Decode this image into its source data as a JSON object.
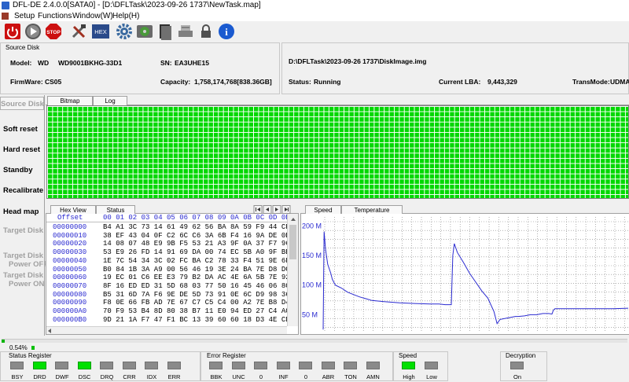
{
  "title": "DFL-DE 2.4.0.0[SATA0] - [D:\\DFLTask\\2023-09-26 1737\\NewTask.map]",
  "menu": [
    "Setup",
    "Functions",
    "Window(W)",
    "Help(H)"
  ],
  "toolbar": [
    {
      "name": "power-icon",
      "color": "#cc1010"
    },
    {
      "name": "play-icon",
      "color": "#404040"
    },
    {
      "name": "stop-icon",
      "color": "#cc1010",
      "label": "STOP"
    },
    {
      "name": "tools-icon",
      "color": "#505050"
    },
    {
      "name": "hex-icon",
      "color": "#2a4a8a",
      "label": "HEX"
    },
    {
      "name": "gear-icon",
      "color": "#3a6aa0"
    },
    {
      "name": "refresh-disk-icon",
      "color": "#4a8a3a"
    },
    {
      "name": "document-icon",
      "color": "#404040"
    },
    {
      "name": "disk-tools-icon",
      "color": "#606060"
    },
    {
      "name": "lock-icon",
      "color": "#505050"
    },
    {
      "name": "info-icon",
      "color": "#1a5ad0",
      "label": "i"
    }
  ],
  "source_disk": {
    "group_label": "Source Disk",
    "model_label": "Model:",
    "model_vendor": "WD",
    "model": "WD9001BKHG-33D1",
    "sn_label": "SN:",
    "sn": "EA3UHE15",
    "firmware_label": "FirmWare:",
    "firmware": "CS05",
    "capacity_label": "Capacity:",
    "capacity": "1,758,174,768[838.36GB]"
  },
  "task": {
    "image_path": "D:\\DFLTask\\2023-09-26 1737\\DiskImage.img",
    "status_label": "Status:",
    "status": "Running",
    "lba_label": "Current LBA:",
    "lba": "9,443,329",
    "transmode_label": "TransMode:",
    "transmode": "UDMA"
  },
  "sidebar": {
    "source_disk": "Source Disk",
    "soft_reset": "Soft reset",
    "hard_reset": "Hard reset",
    "standby": "Standby",
    "recalibrate": "Recalibrate",
    "head_map": "Head map",
    "target_disk": "Target Disk",
    "target_power_off": [
      "Target Disk",
      "Power OFF"
    ],
    "target_power_on": [
      "Target Disk",
      "Power ON"
    ]
  },
  "bitmap_tabs": [
    "Bitmap",
    "Log"
  ],
  "bitmap": {
    "cell_color": "#00d800",
    "filled_fraction": 1.0
  },
  "hex_tabs": [
    "Hex View",
    "Status"
  ],
  "hex": {
    "offset_header": "Offset",
    "col_header": "00 01 02 03 04 05 06 07 08 09 0A 0B 0C 0D 0E",
    "rows": [
      {
        "offset": "00000000",
        "bytes": "B4 A1 3C 73 14 61 49 62 56 BA 8A 59 F9 44 CF"
      },
      {
        "offset": "00000010",
        "bytes": "38 EF 43 04 0F C2 6C C6 3A 6B F4 16 9A DE 0E"
      },
      {
        "offset": "00000020",
        "bytes": "14 08 07 48 E9 9B F5 53 21 A3 9F 0A 37 F7 96"
      },
      {
        "offset": "00000030",
        "bytes": "53 E9 26 FD 14 91 69 DA 00 74 EC 5B A0 9F BE"
      },
      {
        "offset": "00000040",
        "bytes": "1E 7C 54 34 3C 02 FC BA C2 78 33 F4 51 9E 6F"
      },
      {
        "offset": "00000050",
        "bytes": "B0 84 1B 3A A9 00 56 46 19 3E 24 BA 7E D8 DC"
      },
      {
        "offset": "00000060",
        "bytes": "19 EC 01 C6 EE E3 79 B2 DA AC 4E 6A 5B 7E 92"
      },
      {
        "offset": "00000070",
        "bytes": "8F 16 ED ED 31 5D 68 03 77 50 16 45 46 06 8C"
      },
      {
        "offset": "00000080",
        "bytes": "B5 31 6D 7A F6 9E DE 5D 73 91 0E 6C D9 98 36"
      },
      {
        "offset": "00000090",
        "bytes": "F8 0E 66 FB AD 7E 67 C7 C5 C4 00 A2 7E B8 D4"
      },
      {
        "offset": "000000A0",
        "bytes": "70 F9 53 B4 8D 80 38 B7 11 E0 94 ED 27 C4 AC"
      },
      {
        "offset": "000000B0",
        "bytes": "9D 21 1A F7 47 F1 BC 13 39 60 60 18 D3 4E CD"
      }
    ]
  },
  "speed_tabs": [
    "Speed",
    "Temperature"
  ],
  "chart_data": {
    "type": "line",
    "title": "",
    "xlabel": "",
    "ylabel": "",
    "yticks": [
      "200 M",
      "150 M",
      "100 M",
      "50 M"
    ],
    "ytick_values": [
      200,
      150,
      100,
      50
    ],
    "ylim": [
      20,
      215
    ],
    "xlim": [
      0,
      100
    ],
    "grid": true,
    "line_color": "#2a2ad0",
    "x": [
      0,
      0.3,
      0.8,
      1.5,
      2.5,
      3,
      4,
      6,
      8,
      10,
      12,
      14,
      16,
      18,
      20,
      25,
      30,
      35,
      38,
      40,
      42,
      42.5,
      43,
      44,
      46,
      48,
      50,
      52,
      54,
      56,
      57,
      58,
      60,
      62,
      63,
      64,
      66,
      68,
      70,
      72,
      74,
      75,
      75.5,
      76,
      80,
      85,
      90,
      95,
      100
    ],
    "values": [
      25,
      190,
      160,
      135,
      120,
      110,
      100,
      95,
      88,
      84,
      80,
      77,
      74,
      73,
      72,
      70,
      69,
      68,
      68,
      67,
      67,
      150,
      170,
      155,
      138,
      120,
      105,
      90,
      78,
      55,
      35,
      42,
      44,
      46,
      47,
      47,
      48,
      50,
      50,
      52,
      52,
      51,
      58,
      60,
      60,
      60,
      60,
      60,
      61
    ]
  },
  "progress": {
    "label": "0.54%",
    "value": 0.54
  },
  "status_register": {
    "label": "Status Register",
    "bits": [
      {
        "name": "BSY",
        "on": false
      },
      {
        "name": "DRD",
        "on": true
      },
      {
        "name": "DWF",
        "on": false
      },
      {
        "name": "DSC",
        "on": true
      },
      {
        "name": "DRQ",
        "on": false
      },
      {
        "name": "CRR",
        "on": false
      },
      {
        "name": "IDX",
        "on": false
      },
      {
        "name": "ERR",
        "on": false
      }
    ]
  },
  "error_register": {
    "label": "Error Register",
    "bits": [
      {
        "name": "BBK",
        "on": false
      },
      {
        "name": "UNC",
        "on": false
      },
      {
        "name": "0",
        "on": false
      },
      {
        "name": "INF",
        "on": false
      },
      {
        "name": "0",
        "on": false
      },
      {
        "name": "ABR",
        "on": false
      },
      {
        "name": "TON",
        "on": false
      },
      {
        "name": "AMN",
        "on": false
      }
    ]
  },
  "speed": {
    "label": "Speed",
    "bits": [
      {
        "name": "High",
        "on": true
      },
      {
        "name": "Low",
        "on": false
      }
    ]
  },
  "decryption": {
    "label": "Decryption",
    "bits": [
      {
        "name": "On",
        "on": false
      }
    ]
  }
}
